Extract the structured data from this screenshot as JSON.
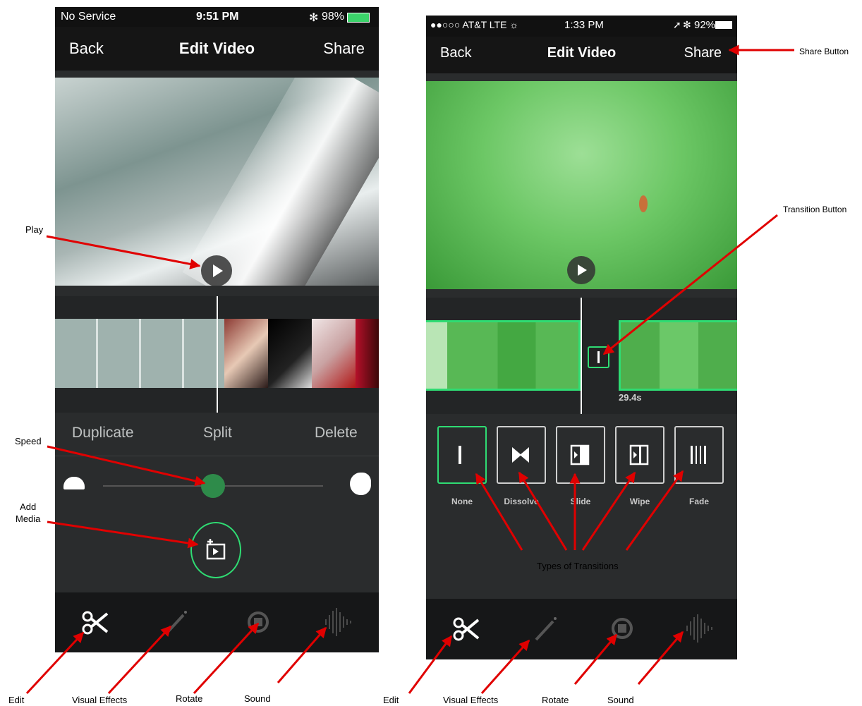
{
  "left_phone": {
    "status": {
      "carrier": "No Service",
      "time": "9:51 PM",
      "battery": "98%"
    },
    "nav": {
      "back": "Back",
      "title": "Edit Video",
      "share": "Share"
    },
    "actions": {
      "duplicate": "Duplicate",
      "split": "Split",
      "delete": "Delete"
    },
    "speed_slider": {
      "value": 0.5
    },
    "tabs": [
      "scissors-icon",
      "magic-wand-icon",
      "rotate-icon",
      "waveform-icon"
    ]
  },
  "right_phone": {
    "status": {
      "carrier": "●●○○○ AT&T  LTE ☼",
      "time": "1:33 PM",
      "battery": "92%"
    },
    "nav": {
      "back": "Back",
      "title": "Edit Video",
      "share": "Share"
    },
    "clip_duration": "29.4s",
    "transitions": [
      {
        "label": "None",
        "selected": true
      },
      {
        "label": "Dissolve",
        "selected": false
      },
      {
        "label": "Slide",
        "selected": false
      },
      {
        "label": "Wipe",
        "selected": false
      },
      {
        "label": "Fade",
        "selected": false
      }
    ]
  },
  "annotations": {
    "play": "Play",
    "speed": "Speed",
    "add_media": "Add\nMedia",
    "share_button": "Share Button",
    "transition_button": "Transition Button",
    "types_of_transitions": "Types of Transitions",
    "edit_left": "Edit",
    "visual_effects_left": "Visual Effects",
    "rotate_left": "Rotate",
    "sound_left": "Sound",
    "edit_right": "Edit",
    "visual_effects_right": "Visual Effects",
    "rotate_right": "Rotate",
    "sound_right": "Sound"
  },
  "colors": {
    "accent_green": "#2fdc73",
    "arrow_red": "#e00000",
    "background_dark": "#2a2c2d"
  }
}
